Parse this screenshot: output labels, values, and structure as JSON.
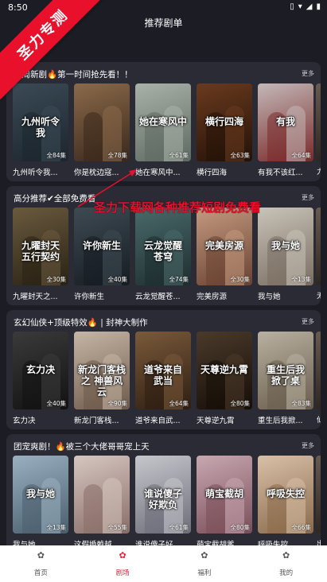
{
  "status_bar": {
    "time": "8:50",
    "icons": [
      "vibrate-icon",
      "wifi-icon",
      "signal-icon",
      "battery-icon"
    ]
  },
  "header": {
    "title": "推荐剧单"
  },
  "watermark": {
    "ribbon_text": "圣力专测"
  },
  "promo_text": "圣力下载网各种推荐短剧免费看",
  "sections": [
    {
      "title": "每周新剧🔥第一时间抢先看！！",
      "more_label": "更多",
      "items": [
        {
          "title": "九州听令我...",
          "poster_text": "九州听令 我",
          "episodes": "全84集",
          "colors": [
            "#3a4a55",
            "#1c262e"
          ]
        },
        {
          "title": "你是枕边寇...",
          "poster_text": "",
          "episodes": "全78集",
          "colors": [
            "#8b6a4a",
            "#3a281c"
          ]
        },
        {
          "title": "她在寒风中...",
          "poster_text": "她在寒风中",
          "episodes": "全61集",
          "colors": [
            "#a9b2a8",
            "#5e6a62"
          ]
        },
        {
          "title": "横行四海",
          "poster_text": "横行四海",
          "episodes": "全63集",
          "colors": [
            "#6a3a1e",
            "#241208"
          ]
        },
        {
          "title": "有我不该红...",
          "poster_text": "有我",
          "episodes": "全64集",
          "colors": [
            "#c4b8b8",
            "#7a2a2a"
          ]
        }
      ],
      "peek_title": "力"
    },
    {
      "title": "高分推荐✔全部免费看",
      "more_label": "更多",
      "items": [
        {
          "title": "九曜封天之...",
          "poster_text": "九曜封天 五行契约",
          "episodes": "全30集",
          "colors": [
            "#6a5a3e",
            "#2a2214"
          ]
        },
        {
          "title": "许你新生",
          "poster_text": "许你新生",
          "episodes": "全40集",
          "colors": [
            "#3e4a52",
            "#161c22"
          ]
        },
        {
          "title": "云龙觉醒苍...",
          "poster_text": "云龙觉醒 苍穹",
          "episodes": "全74集",
          "colors": [
            "#4a6a6a",
            "#1e2e30"
          ]
        },
        {
          "title": "完美房源",
          "poster_text": "完美房源",
          "episodes": "全30集",
          "colors": [
            "#c49a80",
            "#6a4232"
          ]
        },
        {
          "title": "我与她",
          "poster_text": "我与她",
          "episodes": "全13集",
          "colors": [
            "#c9c3b8",
            "#7a6e62"
          ]
        }
      ],
      "peek_title": "无"
    },
    {
      "title": "玄幻仙侠+顶级特效🔥 | 封神大制作",
      "more_label": "更多",
      "items": [
        {
          "title": "玄力决",
          "poster_text": "玄力决",
          "episodes": "全40集",
          "colors": [
            "#3a3a3a",
            "#121212"
          ]
        },
        {
          "title": "新龙门客栈...",
          "poster_text": "新龙门客栈之 神兽风云",
          "episodes": "全90集",
          "colors": [
            "#c6b6a6",
            "#6e5a4a"
          ]
        },
        {
          "title": "道爷来自武...",
          "poster_text": "道爷来自 武当",
          "episodes": "全64集",
          "colors": [
            "#7a5a3a",
            "#2e1e12"
          ]
        },
        {
          "title": "天尊逆九霄",
          "poster_text": "天尊逆九霄",
          "episodes": "全80集",
          "colors": [
            "#4a3a2a",
            "#160e08"
          ]
        },
        {
          "title": "重生后我掀...",
          "poster_text": "重生后我 掀了桌",
          "episodes": "全83集",
          "colors": [
            "#b8b0a0",
            "#6a5e4e"
          ]
        }
      ],
      "peek_title": "仙"
    },
    {
      "title": "团宠爽剧！🔥被三个大佬哥哥宠上天",
      "more_label": "更多",
      "items": [
        {
          "title": "我与她",
          "poster_text": "我与她",
          "episodes": "全13集",
          "colors": [
            "#9ab0c0",
            "#4a5e6e"
          ]
        },
        {
          "title": "这假婚赖越...",
          "poster_text": "",
          "episodes": "全55集",
          "colors": [
            "#d6c6c0",
            "#8a6e68"
          ]
        },
        {
          "title": "谁说傻子好...",
          "poster_text": "谁说傻子 好欺负",
          "episodes": "全61集",
          "colors": [
            "#c6c6cc",
            "#6e6e7a"
          ]
        },
        {
          "title": "萌宝截胡爹...",
          "poster_text": "萌宝截胡",
          "episodes": "全80集",
          "colors": [
            "#c8a8b0",
            "#7a4e5a"
          ]
        },
        {
          "title": "呼吸失控",
          "poster_text": "呼吸失控",
          "episodes": "全66集",
          "colors": [
            "#d8c0a8",
            "#8a6a4a"
          ]
        }
      ],
      "peek_title": "出"
    }
  ],
  "bottom_nav": {
    "items": [
      {
        "label": "首页",
        "icon": "home-icon",
        "active": false
      },
      {
        "label": "剧场",
        "icon": "theater-icon",
        "active": true
      },
      {
        "label": "福利",
        "icon": "gift-icon",
        "active": false
      },
      {
        "label": "我的",
        "icon": "profile-icon",
        "active": false
      }
    ]
  },
  "colors": {
    "accent": "#e0243c",
    "background": "#1b1c24",
    "section_bg": "#2a2b35",
    "ribbon": "#e8102a"
  }
}
